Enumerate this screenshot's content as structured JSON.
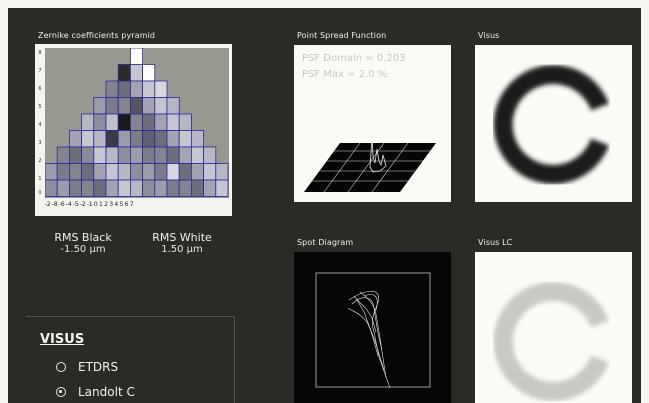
{
  "pyramid": {
    "title": "Zernike coefficients pyramid",
    "y_labels": [
      "8",
      "7",
      "6",
      "5",
      "4",
      "3",
      "2",
      "1",
      "0"
    ],
    "x_labels": "-2 -8 -6 -4 -5 -2 -1 0 1 2 3 4 5 6 7"
  },
  "rms": {
    "black_label": "RMS Black",
    "black_value": "-1.50 µm",
    "white_label": "RMS White",
    "white_value": "1.50 µm"
  },
  "psf": {
    "title": "Point Spread Function",
    "domain": "PSF Domain = 0.203",
    "max": "PSF Max = 2.0 %"
  },
  "visus": {
    "title": "Visus"
  },
  "spot": {
    "title": "Spot Diagram"
  },
  "visus_lc": {
    "title": "Visus LC"
  },
  "visus_panel": {
    "heading": "VISUS",
    "options": [
      {
        "label": "ETDRS",
        "selected": false
      },
      {
        "label": "Landolt C",
        "selected": true
      }
    ]
  }
}
